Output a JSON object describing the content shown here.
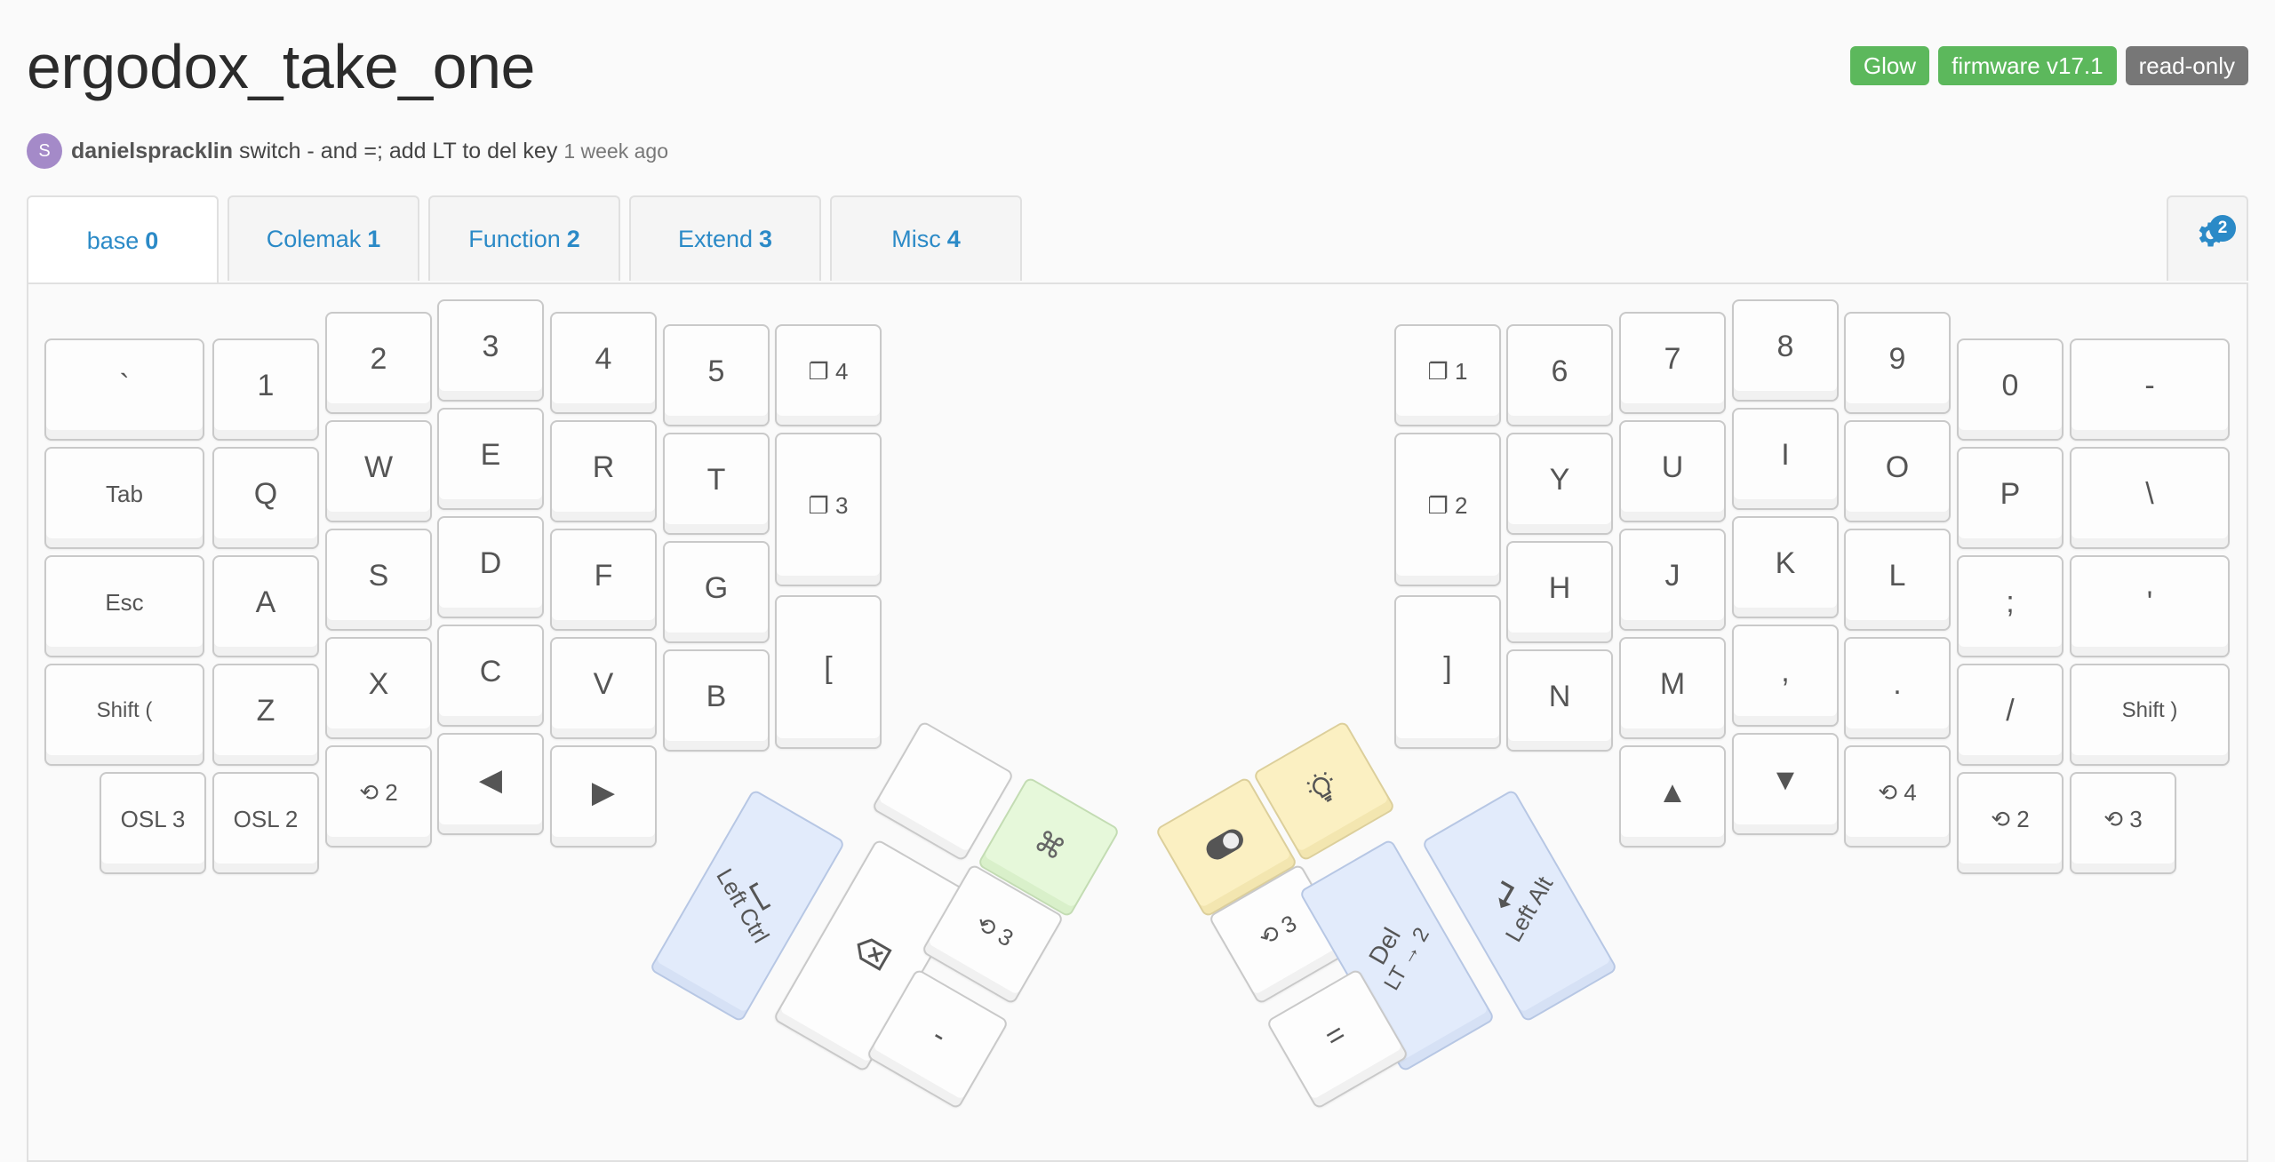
{
  "layout_title": "ergodox_take_one",
  "badges": {
    "glow": "Glow",
    "firmware": "firmware v17.1",
    "readonly": "read-only"
  },
  "revision": {
    "avatar_letter": "S",
    "author": "danielspracklin",
    "message": "switch - and =; add LT to del key",
    "time": "1 week ago"
  },
  "tabs": [
    {
      "name": "base",
      "num": "0"
    },
    {
      "name": "Colemak",
      "num": "1"
    },
    {
      "name": "Function",
      "num": "2"
    },
    {
      "name": "Extend",
      "num": "3"
    },
    {
      "name": "Misc",
      "num": "4"
    }
  ],
  "settings": {
    "icon": "gear-icon",
    "count": "2"
  },
  "left_keys": {
    "r0": [
      "`",
      "1",
      "2",
      "3",
      "4",
      "5",
      "❐ 4"
    ],
    "r1": [
      "Tab",
      "Q",
      "W",
      "E",
      "R",
      "T",
      "❐ 3"
    ],
    "r2": [
      "Esc",
      "A",
      "S",
      "D",
      "F",
      "G"
    ],
    "r3": [
      "Shift (",
      "Z",
      "X",
      "C",
      "V",
      "B",
      "["
    ],
    "r4": [
      "OSL 3",
      "OSL 2",
      "⟲ 2",
      "◀",
      "▶"
    ]
  },
  "right_keys": {
    "r0": [
      "❐ 1",
      "6",
      "7",
      "8",
      "9",
      "0",
      "-"
    ],
    "r1": [
      "❐ 2",
      "Y",
      "U",
      "I",
      "O",
      "P",
      "\\"
    ],
    "r2": [
      "H",
      "J",
      "K",
      "L",
      ";",
      "'"
    ],
    "r3": [
      "]",
      "N",
      "M",
      ",",
      ".",
      "/",
      "Shift )"
    ],
    "r4": [
      "▲",
      "▼",
      "⟲ 4",
      "⟲ 2",
      "⟲ 3"
    ]
  },
  "left_thumb": {
    "ctrl_label": "Left Ctrl",
    "ctrl_icon": "space-icon",
    "backspace_icon": "backspace-icon",
    "cmd_icon": "command-icon",
    "layer": "⟲ 3",
    "minus": "-"
  },
  "right_thumb": {
    "toggle_icon": "toggle-icon",
    "bulb_icon": "lightbulb-icon",
    "layer": "⟲ 3",
    "del": "Del",
    "del_sub": "LT → 2",
    "alt_label": "Left Alt",
    "enter_icon": "enter-icon",
    "equals": "="
  },
  "colors": {
    "accent": "#2b8ac7",
    "blue_key": "#e2ebfb",
    "yellow_key": "#fbf0c2",
    "green_key": "#e6f8da"
  }
}
